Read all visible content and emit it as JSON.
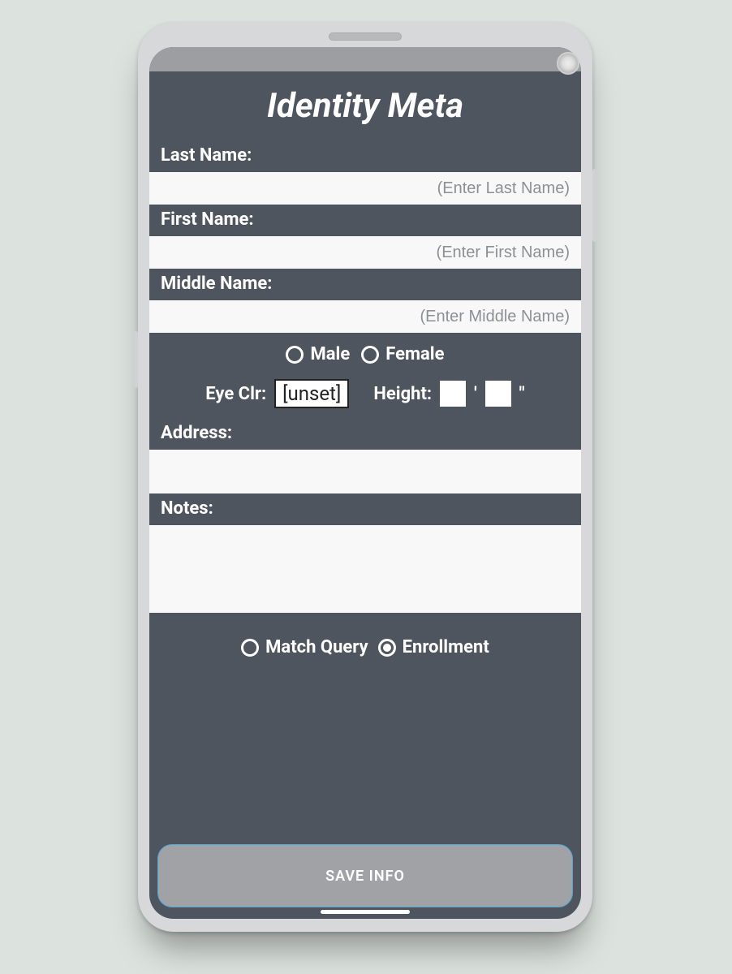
{
  "title": "Identity Meta",
  "fields": {
    "last_name": {
      "label": "Last Name:",
      "placeholder": "(Enter Last Name)",
      "value": ""
    },
    "first_name": {
      "label": "First Name:",
      "placeholder": "(Enter First Name)",
      "value": ""
    },
    "middle_name": {
      "label": "Middle Name:",
      "placeholder": "(Enter Middle Name)",
      "value": ""
    },
    "address": {
      "label": "Address:",
      "value": ""
    },
    "notes": {
      "label": "Notes:",
      "value": ""
    }
  },
  "gender": {
    "options": {
      "male": "Male",
      "female": "Female"
    },
    "selected": null
  },
  "attrs": {
    "eye_label": "Eye Clr:",
    "eye_value": "[unset]",
    "height_label": "Height:",
    "height_ft": "",
    "height_in": "",
    "ft_mark": "'",
    "in_mark": "\""
  },
  "mode": {
    "options": {
      "match": "Match Query",
      "enroll": "Enrollment"
    },
    "selected": "enroll"
  },
  "save_label": "SAVE INFO"
}
